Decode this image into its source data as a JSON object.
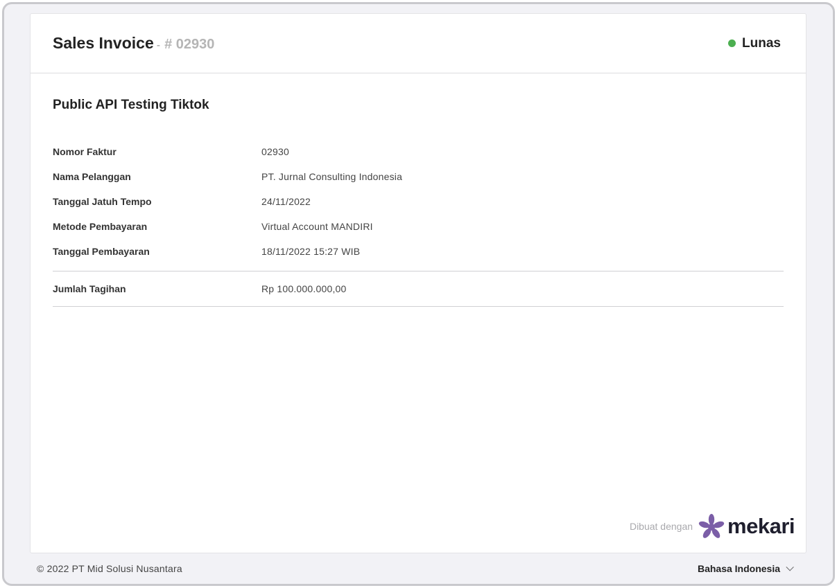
{
  "invoice": {
    "title": "Sales Invoice",
    "separator": "-",
    "number_display": "# 02930",
    "status": "Lunas",
    "status_color": "#4caf50",
    "customer_heading": "Public API Testing Tiktok",
    "details": [
      {
        "label": "Nomor Faktur",
        "value": "02930"
      },
      {
        "label": "Nama Pelanggan",
        "value": "PT. Jurnal Consulting Indonesia"
      },
      {
        "label": "Tanggal Jatuh Tempo",
        "value": "24/11/2022"
      },
      {
        "label": "Metode Pembayaran",
        "value": "Virtual Account MANDIRI"
      },
      {
        "label": "Tanggal Pembayaran",
        "value": "18/11/2022 15:27 WIB"
      }
    ],
    "total": {
      "label": "Jumlah Tagihan",
      "value": "Rp 100.000.000,00"
    }
  },
  "branding": {
    "powered_text": "Dibuat dengan",
    "logo_word": "mekari",
    "logo_icon": "mekari-star-icon",
    "logo_color": "#7b5ea7"
  },
  "footer": {
    "copyright": "© 2022 PT Mid Solusi Nusantara",
    "language": "Bahasa Indonesia",
    "language_icon": "chevron-down-icon"
  }
}
